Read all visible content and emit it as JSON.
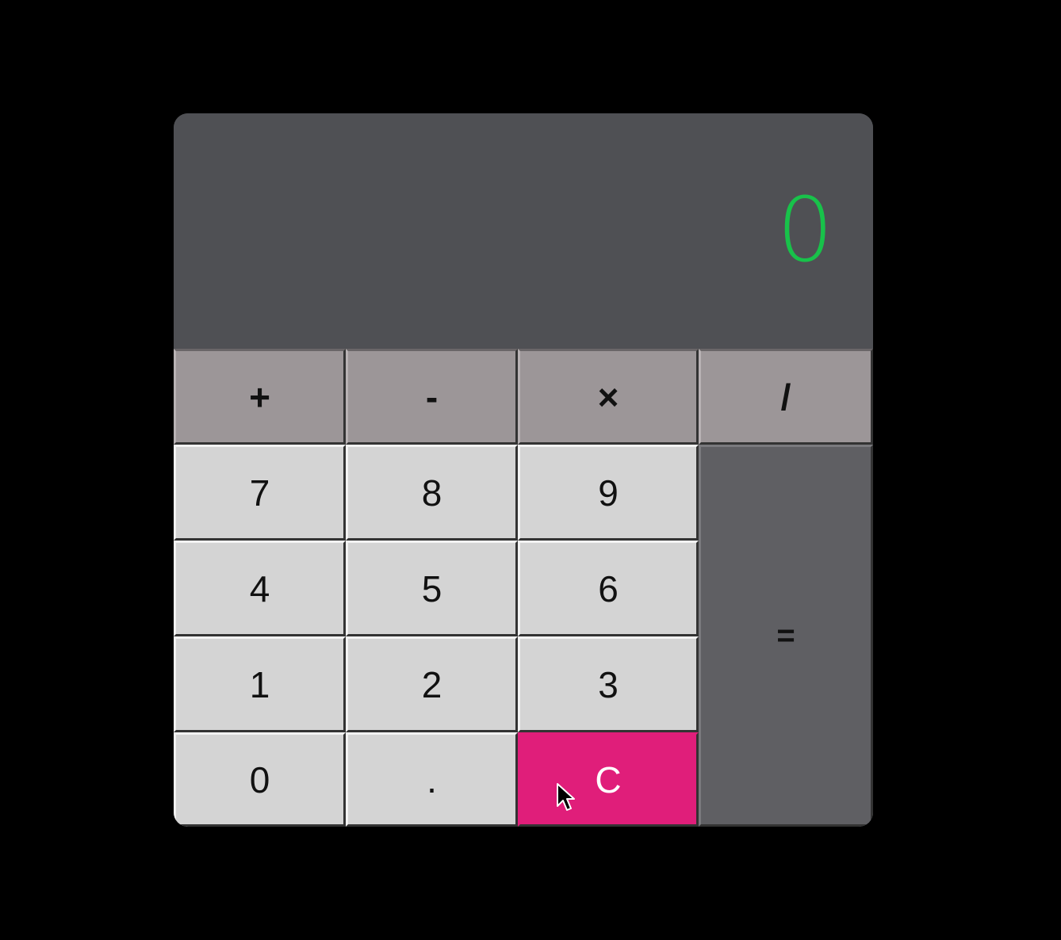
{
  "display": {
    "value": "0"
  },
  "operators": [
    {
      "label": "+",
      "name": "add-button"
    },
    {
      "label": "-",
      "name": "subtract-button"
    },
    {
      "label": "×",
      "name": "multiply-button"
    },
    {
      "label": "/",
      "name": "divide-button"
    }
  ],
  "digits": {
    "seven": "7",
    "eight": "8",
    "nine": "9",
    "four": "4",
    "five": "5",
    "six": "6",
    "one": "1",
    "two": "2",
    "three": "3",
    "zero": "0",
    "decimal": "."
  },
  "actions": {
    "equals": "=",
    "clear": "C"
  },
  "colors": {
    "background": "#000000",
    "display_bg": "#4f5054",
    "display_text": "#18c24a",
    "digit_key": "#d4d4d4",
    "operator_key": "#9c9698",
    "equals_key": "#5f5f63",
    "clear_key": "#e01e7a"
  },
  "cursor": {
    "icon": "mouse-pointer-icon"
  }
}
